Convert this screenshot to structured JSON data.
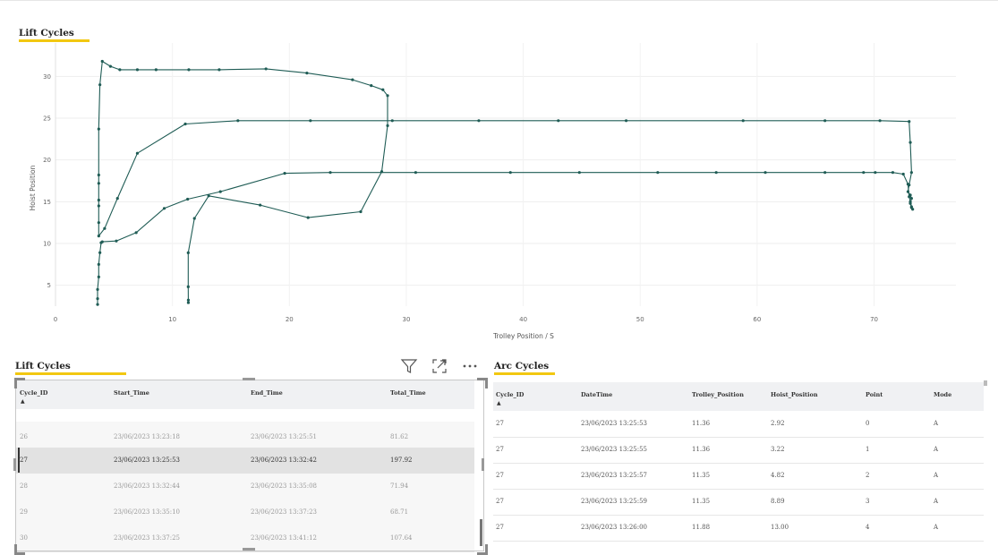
{
  "chart": {
    "title": "Lift Cycles",
    "accent_color": "#f2c811",
    "line_color": "#1f5c55"
  },
  "chart_data": {
    "type": "line",
    "title": "Lift Cycles",
    "xlabel": "Trolley Position / S",
    "ylabel": "Hoist Position",
    "xlim": [
      0,
      77
    ],
    "ylim": [
      2.5,
      34
    ],
    "x_ticks": [
      0,
      10,
      20,
      30,
      40,
      50,
      60,
      70
    ],
    "y_ticks": [
      5,
      10,
      15,
      20,
      25,
      30
    ],
    "grid": true,
    "series": [
      {
        "values": [
          [
            11.36,
            2.92
          ],
          [
            11.36,
            3.22
          ],
          [
            11.35,
            4.82
          ],
          [
            11.35,
            8.89
          ],
          [
            11.88,
            13.0
          ],
          [
            13.1,
            15.7
          ],
          [
            17.5,
            14.6
          ],
          [
            21.6,
            13.1
          ],
          [
            26.1,
            13.8
          ],
          [
            27.9,
            18.6
          ],
          [
            28.4,
            24.1
          ],
          [
            28.4,
            27.7
          ],
          [
            28.0,
            28.4
          ],
          [
            27.0,
            28.9
          ],
          [
            25.4,
            29.6
          ],
          [
            21.5,
            30.4
          ],
          [
            18.0,
            30.9
          ],
          [
            14.0,
            30.8
          ],
          [
            11.4,
            30.8
          ],
          [
            8.6,
            30.8
          ],
          [
            7.0,
            30.8
          ],
          [
            5.5,
            30.8
          ],
          [
            4.7,
            31.2
          ],
          [
            4.0,
            31.8
          ],
          [
            3.8,
            29.0
          ],
          [
            3.7,
            23.7
          ],
          [
            3.7,
            18.2
          ],
          [
            3.7,
            17.2
          ],
          [
            3.7,
            15.2
          ],
          [
            3.7,
            14.5
          ],
          [
            3.7,
            12.5
          ],
          [
            3.7,
            10.9
          ],
          [
            4.2,
            11.8
          ],
          [
            5.3,
            15.4
          ],
          [
            7.0,
            20.8
          ],
          [
            11.1,
            24.3
          ],
          [
            15.6,
            24.7
          ],
          [
            21.8,
            24.7
          ],
          [
            28.8,
            24.7
          ],
          [
            36.2,
            24.7
          ],
          [
            43.0,
            24.7
          ],
          [
            48.8,
            24.7
          ],
          [
            58.8,
            24.7
          ],
          [
            65.8,
            24.7
          ],
          [
            70.5,
            24.7
          ],
          [
            73.0,
            24.6
          ],
          [
            73.1,
            22.1
          ],
          [
            73.2,
            18.5
          ],
          [
            73.0,
            17.0
          ],
          [
            72.9,
            16.2
          ],
          [
            73.1,
            15.8
          ],
          [
            73.2,
            15.4
          ],
          [
            73.1,
            14.8
          ],
          [
            73.2,
            14.3
          ],
          [
            73.3,
            14.1
          ]
        ]
      },
      {
        "values": [
          [
            3.6,
            2.7
          ],
          [
            3.6,
            3.4
          ],
          [
            3.6,
            4.5
          ],
          [
            3.7,
            6.0
          ],
          [
            3.7,
            7.5
          ],
          [
            3.8,
            8.9
          ],
          [
            3.9,
            10.1
          ],
          [
            4.0,
            10.2
          ],
          [
            5.2,
            10.3
          ],
          [
            6.9,
            11.3
          ],
          [
            9.3,
            14.2
          ],
          [
            11.3,
            15.3
          ],
          [
            14.1,
            16.2
          ],
          [
            19.6,
            18.4
          ],
          [
            23.5,
            18.5
          ],
          [
            30.8,
            18.5
          ],
          [
            38.9,
            18.5
          ],
          [
            44.8,
            18.5
          ],
          [
            51.5,
            18.5
          ],
          [
            56.5,
            18.5
          ],
          [
            60.7,
            18.5
          ],
          [
            65.8,
            18.5
          ],
          [
            69.1,
            18.5
          ],
          [
            70.1,
            18.5
          ],
          [
            71.6,
            18.5
          ],
          [
            72.5,
            18.3
          ],
          [
            72.9,
            17.1
          ],
          [
            73.0,
            15.6
          ],
          [
            73.1,
            15.0
          ],
          [
            73.2,
            14.4
          ]
        ]
      }
    ]
  },
  "lift_table": {
    "title": "Lift Cycles",
    "columns": [
      "Cycle_ID",
      "Start_Time",
      "End_Time",
      "Total_Time"
    ],
    "sort_indicator": "▲",
    "selected_index": 1,
    "rows": [
      [
        "26",
        "23/06/2023 13:23:18",
        "23/06/2023 13:25:51",
        "81.62"
      ],
      [
        "27",
        "23/06/2023 13:25:53",
        "23/06/2023 13:32:42",
        "197.92"
      ],
      [
        "28",
        "23/06/2023 13:32:44",
        "23/06/2023 13:35:08",
        "71.94"
      ],
      [
        "29",
        "23/06/2023 13:35:10",
        "23/06/2023 13:37:23",
        "68.71"
      ],
      [
        "30",
        "23/06/2023 13:37:25",
        "23/06/2023 13:41:12",
        "107.64"
      ]
    ],
    "icons": [
      "filter-icon",
      "focus-mode-icon",
      "more-options-icon"
    ]
  },
  "arc_table": {
    "title": "Arc Cycles",
    "columns": [
      "Cycle_ID",
      "DateTime",
      "Trolley_Position",
      "Hoist_Position",
      "Point",
      "Mode"
    ],
    "sort_indicator": "▲",
    "rows": [
      [
        "27",
        "23/06/2023 13:25:53",
        "11.36",
        "2.92",
        "0",
        "A"
      ],
      [
        "27",
        "23/06/2023 13:25:55",
        "11.36",
        "3.22",
        "1",
        "A"
      ],
      [
        "27",
        "23/06/2023 13:25:57",
        "11.35",
        "4.82",
        "2",
        "A"
      ],
      [
        "27",
        "23/06/2023 13:25:59",
        "11.35",
        "8.89",
        "3",
        "A"
      ],
      [
        "27",
        "23/06/2023 13:26:00",
        "11.88",
        "13.00",
        "4",
        "A"
      ]
    ]
  }
}
